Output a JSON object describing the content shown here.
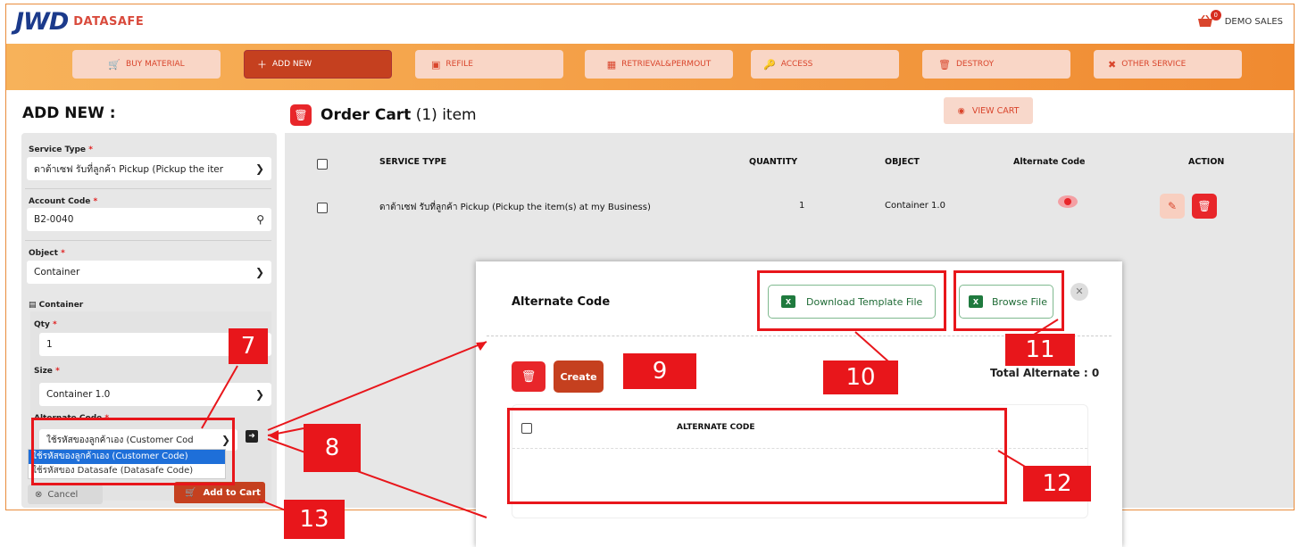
{
  "brand": {
    "logo": "JWD",
    "name": "DATASAFE"
  },
  "user": {
    "cart_count": "0",
    "name": "DEMO SALES"
  },
  "nav": [
    {
      "label": "BUY MATERIAL",
      "icon": "cart-icon"
    },
    {
      "label": "ADD NEW",
      "icon": "plus-icon"
    },
    {
      "label": "REFILE",
      "icon": "folder-plus-icon"
    },
    {
      "label": "RETRIEVAL&PERMOUT",
      "icon": "boxes-icon"
    },
    {
      "label": "ACCESS",
      "icon": "key-icon"
    },
    {
      "label": "DESTROY",
      "icon": "trash-icon"
    },
    {
      "label": "OTHER SERVICE",
      "icon": "tools-icon"
    }
  ],
  "left": {
    "title": "ADD NEW :",
    "service_type_label": "Service Type",
    "service_type_value": "ดาต้าเซฟ รับที่ลูกค้า Pickup (Pickup the iter",
    "account_code_label": "Account Code",
    "account_code_value": "B2-0040",
    "object_label": "Object",
    "object_value": "Container",
    "container_heading": "Container",
    "qty_label": "Qty",
    "qty_value": "1",
    "size_label": "Size",
    "size_value": "Container 1.0",
    "alt_code_label": "Alternate Code",
    "alt_code_value": "ใช้รหัสของลูกค้าเอง (Customer Cod",
    "alt_code_options": [
      "ใช้รหัสของลูกค้าเอง (Customer Code)",
      "ใช้รหัสของ Datasafe (Datasafe Code)"
    ],
    "cancel_label": "Cancel",
    "add_to_cart_label": "Add to Cart"
  },
  "cart": {
    "title": "Order Cart",
    "count": "(1) item",
    "view_cart_label": "VIEW CART",
    "headers": [
      "SERVICE TYPE",
      "QUANTITY",
      "OBJECT",
      "Alternate Code",
      "ACTION"
    ],
    "row": {
      "service_type": "ดาต้าเซฟ รับที่ลูกค้า Pickup (Pickup the item(s) at my Business)",
      "quantity": "1",
      "object": "Container 1.0"
    }
  },
  "modal": {
    "title": "Alternate Code",
    "download_label": "Download Template File",
    "browse_label": "Browse File",
    "create_label": "Create",
    "total_label": "Total Alternate : 0",
    "column_header": "ALTERNATE CODE"
  },
  "callouts": [
    "7",
    "8",
    "9",
    "10",
    "11",
    "12",
    "13"
  ],
  "colors": {
    "accent": "#c5401f",
    "danger": "#e8262a",
    "annotation": "#e8161b",
    "excel": "#1f7a3e"
  }
}
